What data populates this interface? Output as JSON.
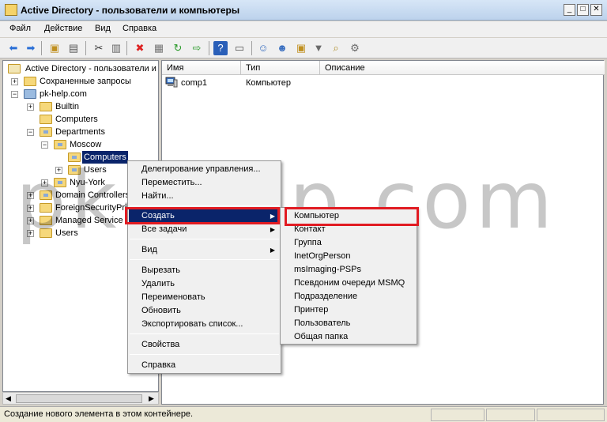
{
  "window": {
    "title": "Active Directory - пользователи и компьютеры"
  },
  "menubar": {
    "items": [
      "Файл",
      "Действие",
      "Вид",
      "Справка"
    ]
  },
  "toolbar": {
    "icons": [
      "back-icon",
      "forward-icon",
      "up-icon",
      "show-hide-tree-icon",
      "cut-icon",
      "paste-icon",
      "delete-icon",
      "properties-icon",
      "refresh-icon",
      "export-icon",
      "help-icon",
      "console-icon",
      "add-user-icon",
      "add-group-icon",
      "add-ou-icon",
      "filter-icon",
      "find-icon",
      "delegate-icon"
    ]
  },
  "tree": {
    "root": "Active Directory - пользователи и",
    "items": [
      {
        "label": "Сохраненные запросы"
      },
      {
        "label": "pk-help.com"
      },
      {
        "label": "Builtin"
      },
      {
        "label": "Computers"
      },
      {
        "label": "Departments"
      },
      {
        "label": "Moscow"
      },
      {
        "label": "Computers"
      },
      {
        "label": "Users"
      },
      {
        "label": "Nyu-York"
      },
      {
        "label": "Domain Controllers"
      },
      {
        "label": "ForeignSecurityPrin"
      },
      {
        "label": "Managed Service A"
      },
      {
        "label": "Users"
      }
    ]
  },
  "list": {
    "columns": [
      "Имя",
      "Тип",
      "Описание"
    ],
    "rows": [
      {
        "name": "comp1",
        "type": "Компьютер",
        "description": ""
      }
    ]
  },
  "context_menu": {
    "items": [
      "Делегирование управления...",
      "Переместить...",
      "Найти...",
      "Создать",
      "Все задачи",
      "Вид",
      "Вырезать",
      "Удалить",
      "Переименовать",
      "Обновить",
      "Экспортировать список...",
      "Свойства",
      "Справка"
    ]
  },
  "submenu": {
    "items": [
      "Компьютер",
      "Контакт",
      "Группа",
      "InetOrgPerson",
      "msImaging-PSPs",
      "Псевдоним очереди MSMQ",
      "Подразделение",
      "Принтер",
      "Пользователь",
      "Общая папка"
    ]
  },
  "status": {
    "text": "Создание нового элемента в этом контейнере."
  },
  "watermark": {
    "text": "pk-help.com"
  },
  "colors": {
    "highlight": "#0a246a",
    "annotation": "#e11b22"
  }
}
